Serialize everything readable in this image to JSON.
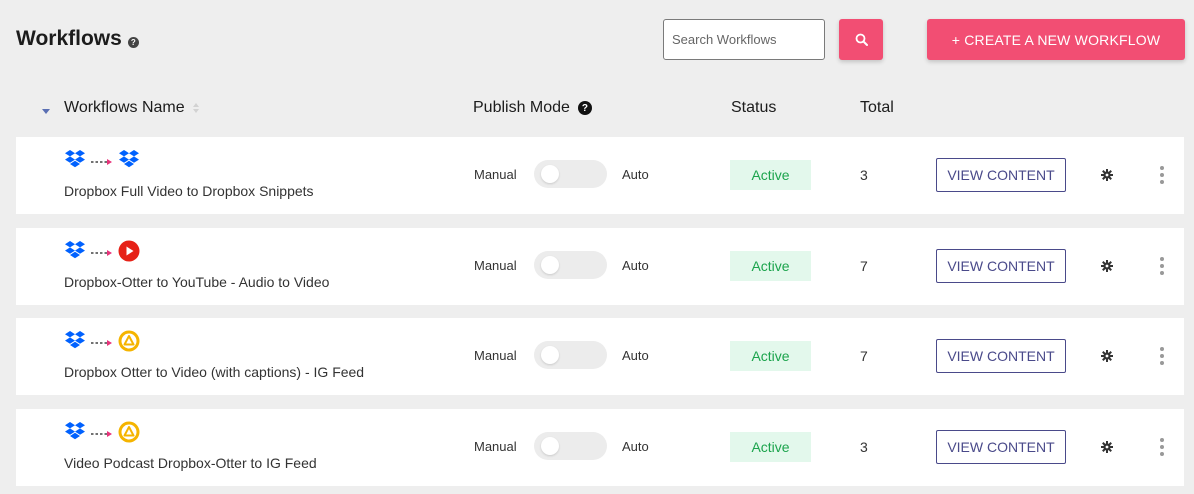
{
  "header": {
    "title": "Workflows",
    "help_icon": "question-circle-icon",
    "search_placeholder": "Search Workflows",
    "search_value": "",
    "search_icon": "search-icon",
    "create_label": "+ CREATE A NEW WORKFLOW"
  },
  "columns": {
    "name": "Workflows Name",
    "publish_mode": "Publish Mode",
    "status": "Status",
    "total": "Total"
  },
  "rows": [
    {
      "name": "Dropbox Full Video to Dropbox Snippets",
      "source_icon": "dropbox-icon",
      "target_icon": "dropbox-icon",
      "manual_label": "Manual",
      "auto_label": "Auto",
      "auto_enabled": false,
      "status": "Active",
      "total": "3",
      "action_label": "VIEW CONTENT"
    },
    {
      "name": "Dropbox-Otter to YouTube - Audio to Video",
      "source_icon": "dropbox-icon",
      "target_icon": "youtube-icon",
      "manual_label": "Manual",
      "auto_label": "Auto",
      "auto_enabled": false,
      "status": "Active",
      "total": "7",
      "action_label": "VIEW CONTENT"
    },
    {
      "name": "Dropbox Otter to Video (with captions) - IG Feed",
      "source_icon": "dropbox-icon",
      "target_icon": "video-app-icon",
      "manual_label": "Manual",
      "auto_label": "Auto",
      "auto_enabled": false,
      "status": "Active",
      "total": "7",
      "action_label": "VIEW CONTENT"
    },
    {
      "name": "Video Podcast Dropbox-Otter to IG Feed",
      "source_icon": "dropbox-icon",
      "target_icon": "video-app-icon",
      "manual_label": "Manual",
      "auto_label": "Auto",
      "auto_enabled": false,
      "status": "Active",
      "total": "3",
      "action_label": "VIEW CONTENT"
    }
  ],
  "colors": {
    "accent": "#f24e73",
    "status_bg": "#e3f8ec",
    "status_text": "#1ca44d",
    "action_border": "#4a4a8a",
    "dropbox": "#0061fe",
    "youtube": "#e62117",
    "video_app": "#f5b400"
  }
}
